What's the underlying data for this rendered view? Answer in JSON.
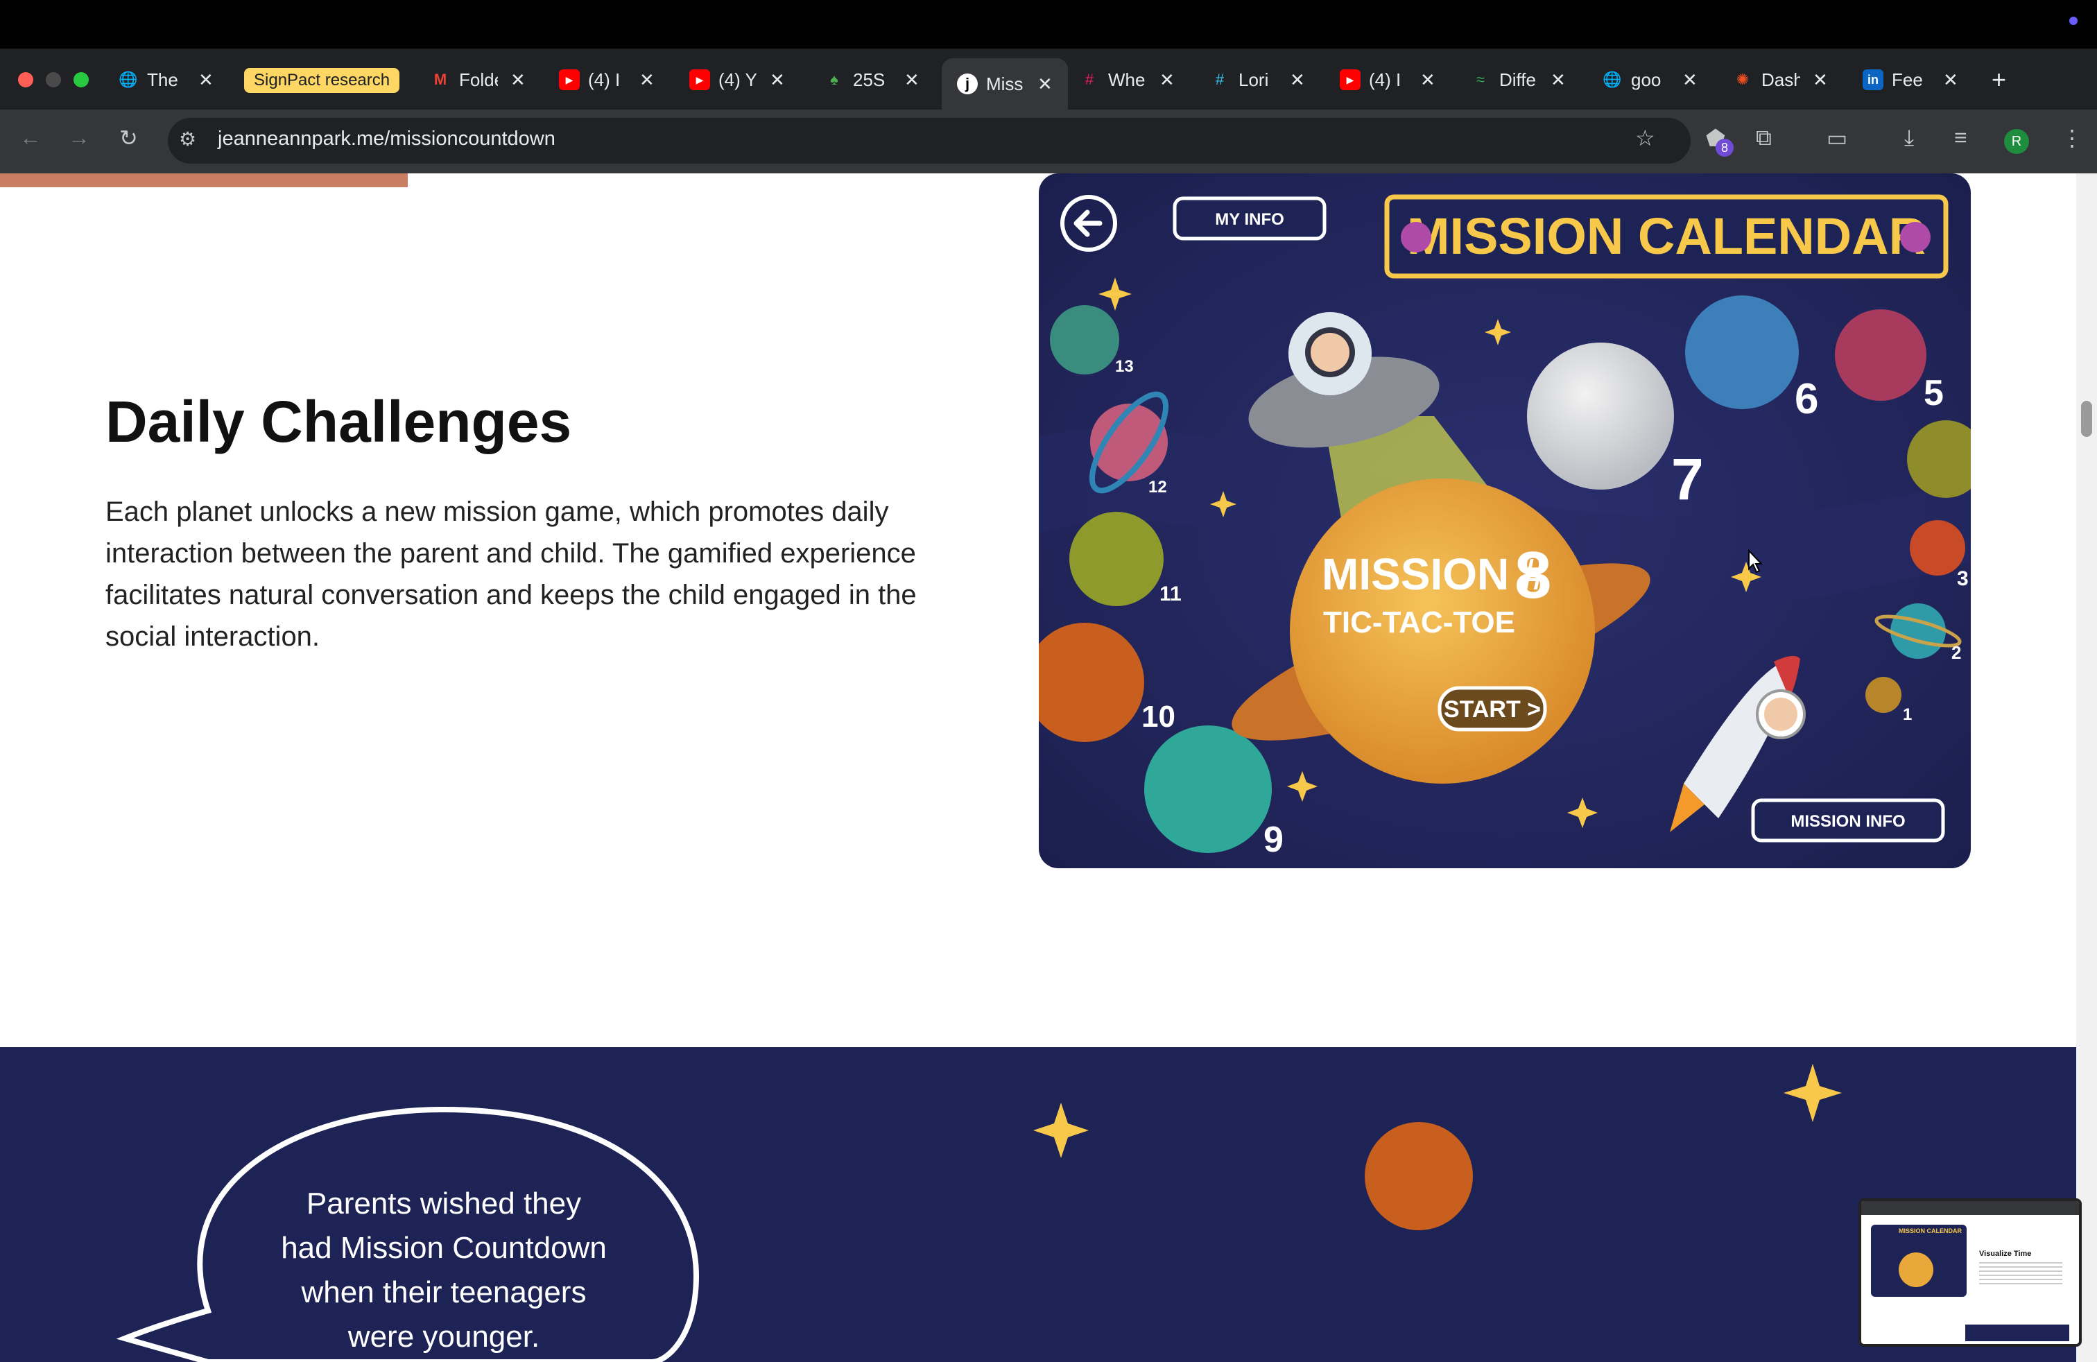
{
  "browser": {
    "tabs": [
      {
        "icon": "globe-icon",
        "title": "The"
      },
      {
        "icon": "tab-group-label",
        "title": "SignPact research"
      },
      {
        "icon": "gmail-icon",
        "title": "Folde"
      },
      {
        "icon": "youtube-icon",
        "title": "(4) I"
      },
      {
        "icon": "youtube-icon",
        "title": "(4) Y"
      },
      {
        "icon": "leaf-icon",
        "title": "25S"
      },
      {
        "icon": "j-icon",
        "title": "Miss"
      },
      {
        "icon": "slack-icon",
        "title": "Whe"
      },
      {
        "icon": "slack-icon",
        "title": "Lori"
      },
      {
        "icon": "youtube-icon",
        "title": "(4) I"
      },
      {
        "icon": "diff-icon",
        "title": "Diffe"
      },
      {
        "icon": "globe-icon",
        "title": "goo"
      },
      {
        "icon": "dashboard-icon",
        "title": "Dash"
      },
      {
        "icon": "linkedin-icon",
        "title": "Fee"
      }
    ],
    "url": "jeanneannpark.me/missioncountdown",
    "extension_badge": "8",
    "profile_initial": "R"
  },
  "section": {
    "heading": "Daily Challenges",
    "body": "Each planet unlocks a new mission game, which promotes daily interaction between the parent and child. The gamified experience facilitates natural conversation and keeps the child engaged in the social interaction."
  },
  "app": {
    "title": "MISSION CALENDAR",
    "my_info": "MY INFO",
    "mission_label": "MISSION #",
    "mission_number": "8",
    "mission_game": "TIC-TAC-TOE",
    "start_label": "START >",
    "mission_info": "MISSION INFO",
    "planet_numbers": [
      "13",
      "12",
      "11",
      "10",
      "9",
      "7",
      "6",
      "5",
      "3",
      "2",
      "1"
    ]
  },
  "quote": {
    "text_lines": [
      "Parents wished they",
      "had Mission Countdown",
      "when their teenagers",
      "were younger."
    ]
  },
  "pip": {
    "title": "MISSION CALENDAR",
    "heading": "Visualize Time"
  },
  "colors": {
    "space_bg": "#1e2356",
    "accent_bar": "#c97d63",
    "title_gold": "#f7c84a"
  }
}
